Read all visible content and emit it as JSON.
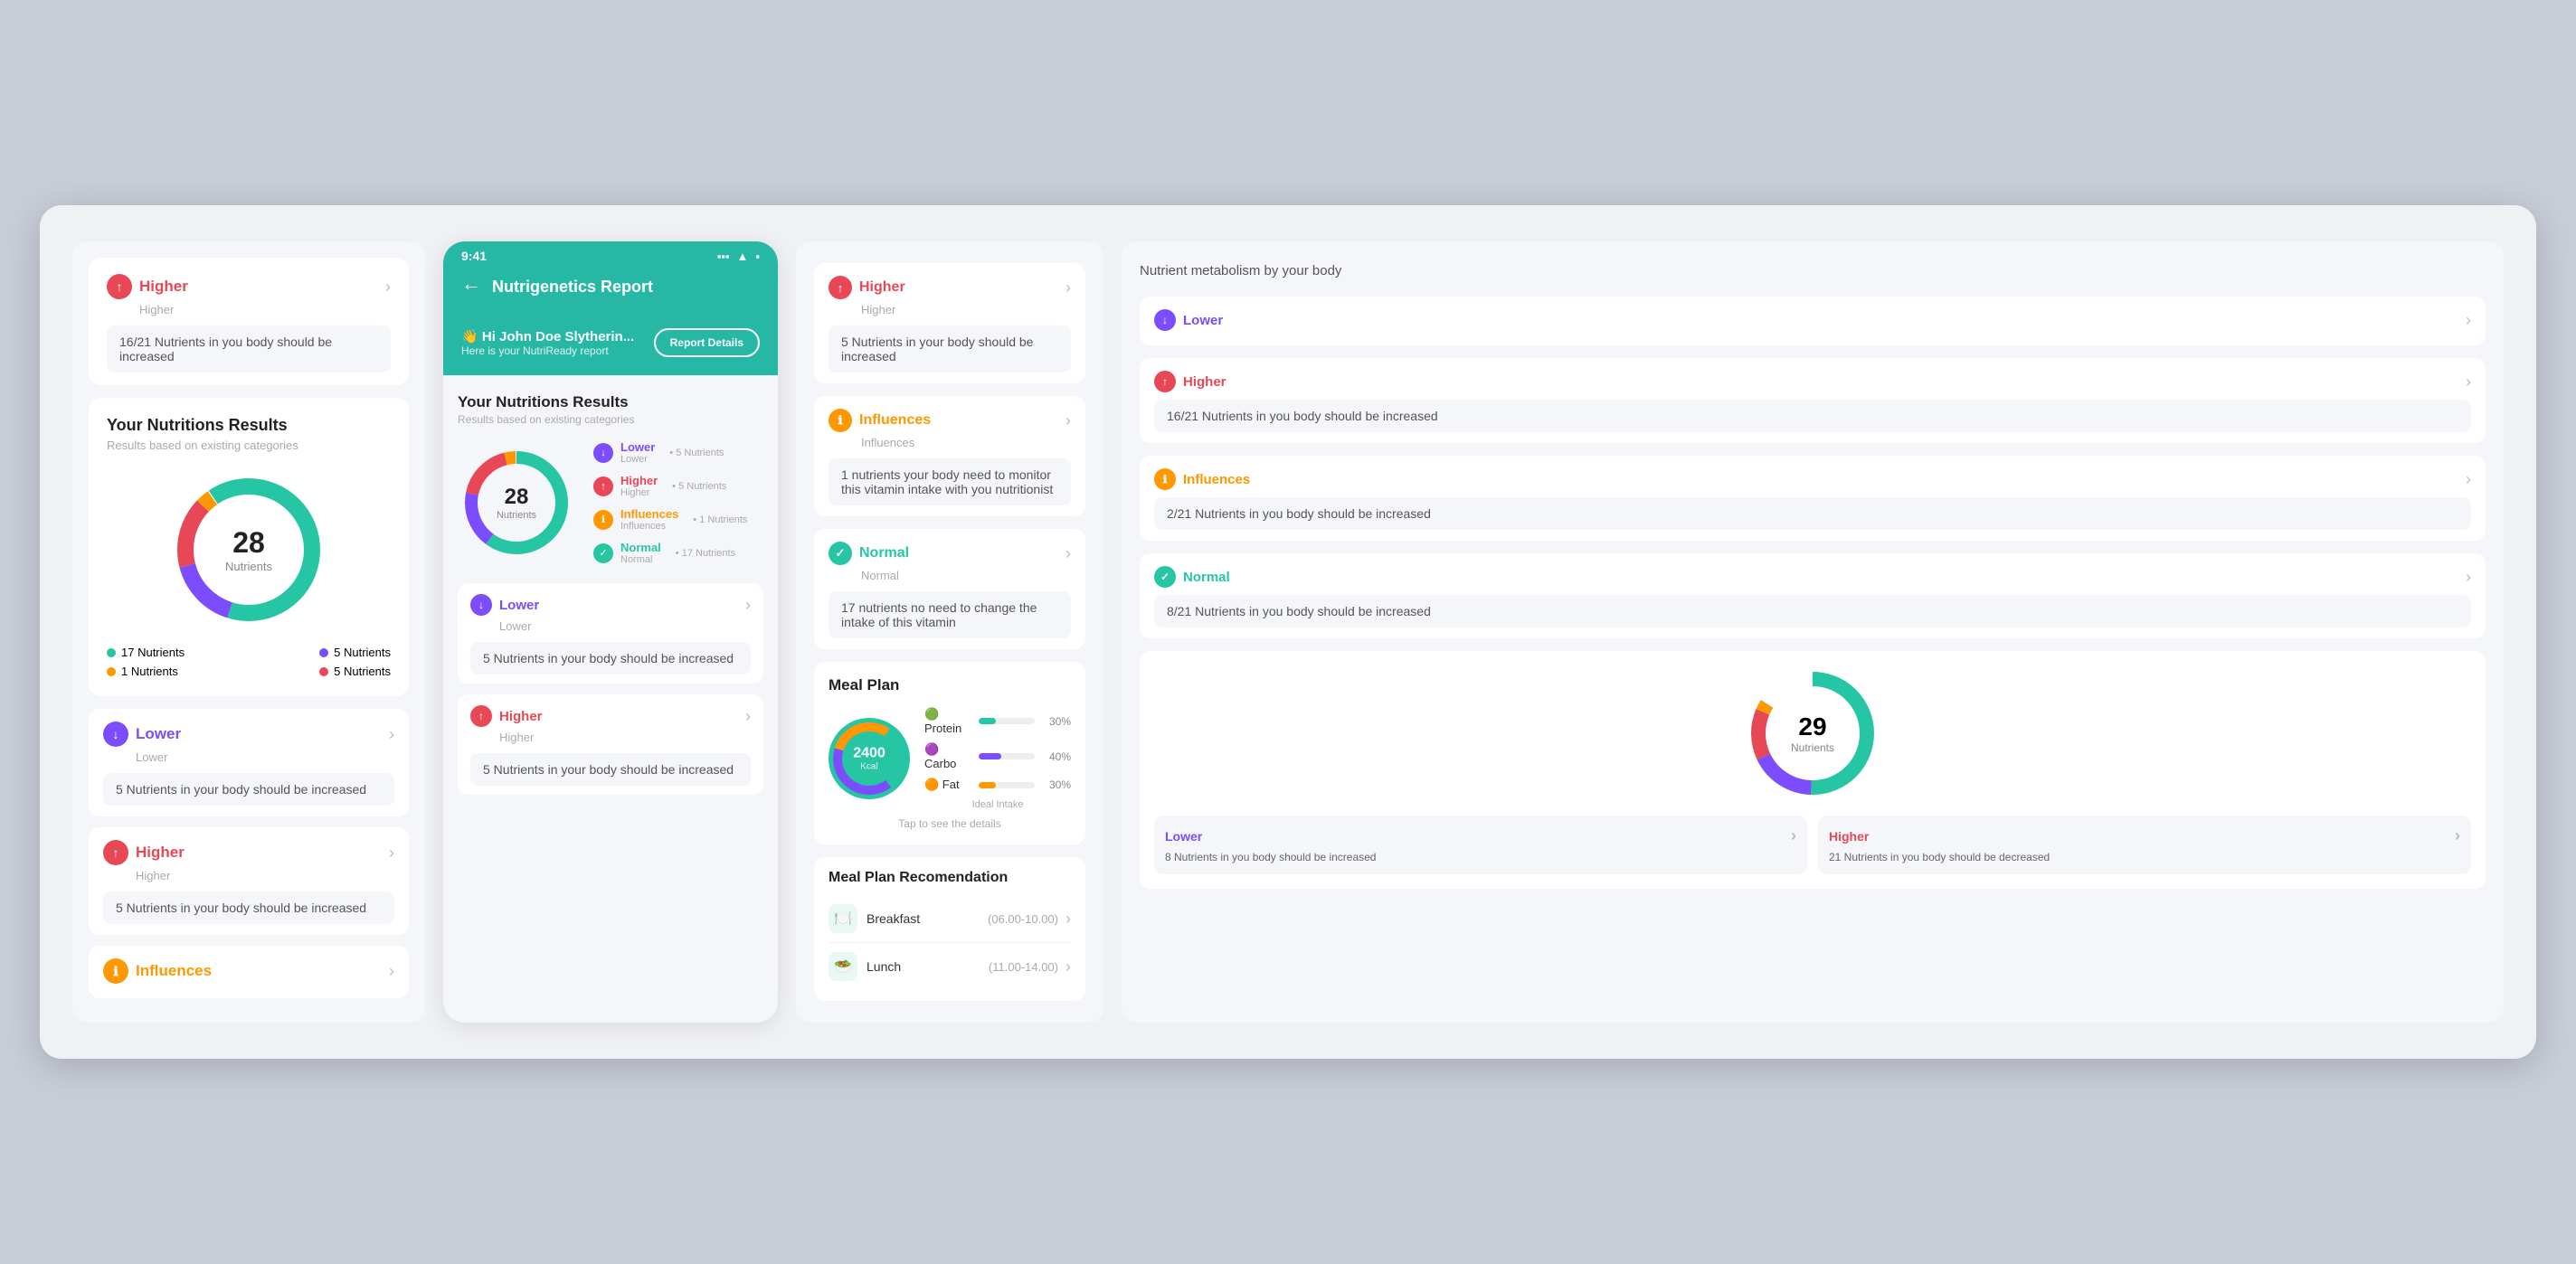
{
  "app": {
    "bg": "#c8cdd8"
  },
  "left": {
    "top_card": {
      "status": "Higher",
      "sub": "Higher",
      "info": "16/21 Nutrients in you body should be increased"
    },
    "nutrition_title": "Your Nutritions Results",
    "nutrition_sub": "Results based on existing categories",
    "donut": {
      "total": 28,
      "label": "Nutrients",
      "segments": [
        {
          "label": "17 Nutrients",
          "color": "#26c6a5",
          "value": 17
        },
        {
          "label": "5 Nutrients",
          "color": "#7c4dff",
          "value": 5
        },
        {
          "label": "5 Nutrients",
          "color": "#e84855",
          "value": 5
        },
        {
          "label": "1 Nutrients",
          "color": "#ff9800",
          "value": 1
        }
      ]
    },
    "cards": [
      {
        "status": "Lower",
        "sub": "Lower",
        "icon_type": "lower",
        "info": "5 Nutrients in your body should be increased"
      },
      {
        "status": "Higher",
        "sub": "Higher",
        "icon_type": "higher",
        "info": "5 Nutrients in your body should be increased"
      },
      {
        "status": "Influences",
        "sub": "",
        "icon_type": "influences",
        "info": ""
      }
    ]
  },
  "phone": {
    "time": "9:41",
    "title": "Nutrigenetics Report",
    "greeting": "Hi John Doe Slytherin...",
    "greeting_sub": "Here is your NutriReady report",
    "report_btn": "Report Details",
    "section_title": "Your Nutritions Results",
    "section_sub": "Results based on existing categories",
    "donut": {
      "total": 28,
      "label": "Nutrients"
    },
    "legend": [
      {
        "label": "Lower",
        "sub": "Lower",
        "count": "5 Nutrients",
        "color": "#7c4dff",
        "icon_type": "lower"
      },
      {
        "label": "Higher",
        "sub": "Higher",
        "count": "5 Nutrients",
        "color": "#e84855",
        "icon_type": "higher"
      },
      {
        "label": "Influences",
        "sub": "Influences",
        "count": "1 Nutrients",
        "color": "#ff9800",
        "icon_type": "influences"
      },
      {
        "label": "Normal",
        "sub": "Normal",
        "count": "17 Nutrients",
        "color": "#26c6a5",
        "icon_type": "normal"
      }
    ],
    "cards": [
      {
        "status": "Lower",
        "sub": "Lower",
        "icon_type": "lower",
        "info": "5 Nutrients in your body should be increased"
      },
      {
        "status": "Higher",
        "sub": "Higher",
        "icon_type": "higher",
        "info": "5 Nutrients in your body should be increased"
      }
    ]
  },
  "center_right": {
    "cards": [
      {
        "status": "Higher",
        "sub": "Higher",
        "icon_type": "higher",
        "info": "5 Nutrients in your body should be increased"
      },
      {
        "status": "Influences",
        "sub": "Influences",
        "icon_type": "influences",
        "info": "1 nutrients your body need to monitor this vitamin intake with you nutritionist"
      },
      {
        "status": "Normal",
        "sub": "Normal",
        "icon_type": "normal",
        "info": "17 nutrients no need to change the intake of this vitamin"
      }
    ],
    "meal_plan": {
      "title": "Meal Plan",
      "kcal": "2400",
      "kcal_unit": "Kcal",
      "ideal_label": "Ideal Intake",
      "tap_label": "Tap to see the details",
      "bars": [
        {
          "name": "Protein",
          "pct": 30,
          "color": "#26c6a5"
        },
        {
          "name": "Carbo",
          "pct": 40,
          "color": "#7c4dff"
        },
        {
          "name": "Fat",
          "pct": 30,
          "color": "#ff9800"
        }
      ]
    },
    "meal_reco": {
      "title": "Meal Plan Recomendation",
      "items": [
        {
          "name": "Breakfast",
          "time": "(06.00-10.00)",
          "emoji": "🍽️"
        },
        {
          "name": "Lunch",
          "time": "(11.00-14.00)",
          "emoji": "🥗"
        }
      ]
    }
  },
  "right": {
    "title": "Nutrient metabolism by your body",
    "cards": [
      {
        "status": "Lower",
        "icon_type": "lower",
        "info": ""
      },
      {
        "status": "Higher",
        "icon_type": "higher",
        "info": "16/21 Nutrients in you body should be increased"
      },
      {
        "status": "Influences",
        "icon_type": "influences",
        "info": "2/21 Nutrients in you body should be increased"
      },
      {
        "status": "Normal",
        "icon_type": "normal",
        "info": "8/21 Nutrients in you body should be increased"
      }
    ],
    "donut": {
      "total": 29,
      "label": "Nutrients"
    },
    "bottom_cards": [
      {
        "status": "Lower",
        "icon_type": "lower",
        "text": "8 Nutrients in you body should be increased"
      },
      {
        "status": "Higher",
        "icon_type": "higher",
        "text": "21 Nutrients in you body should be decreased"
      }
    ]
  }
}
